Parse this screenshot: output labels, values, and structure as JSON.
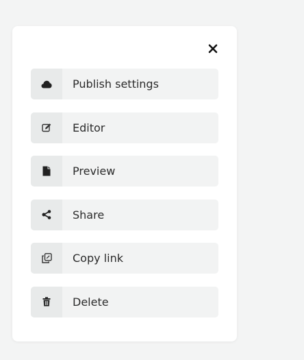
{
  "menu": {
    "close_icon": "close-icon",
    "items": [
      {
        "label": "Publish settings",
        "icon": "cloud-icon"
      },
      {
        "label": "Editor",
        "icon": "edit-icon"
      },
      {
        "label": "Preview",
        "icon": "file-icon"
      },
      {
        "label": "Share",
        "icon": "share-icon"
      },
      {
        "label": "Copy link",
        "icon": "copy-link-icon"
      },
      {
        "label": "Delete",
        "icon": "trash-icon"
      }
    ]
  },
  "colors": {
    "background": "#f3f4f4",
    "panel": "#ffffff",
    "item_background": "#f2f3f3",
    "icon_box": "#e8eaea",
    "text": "#2b2b2b"
  }
}
